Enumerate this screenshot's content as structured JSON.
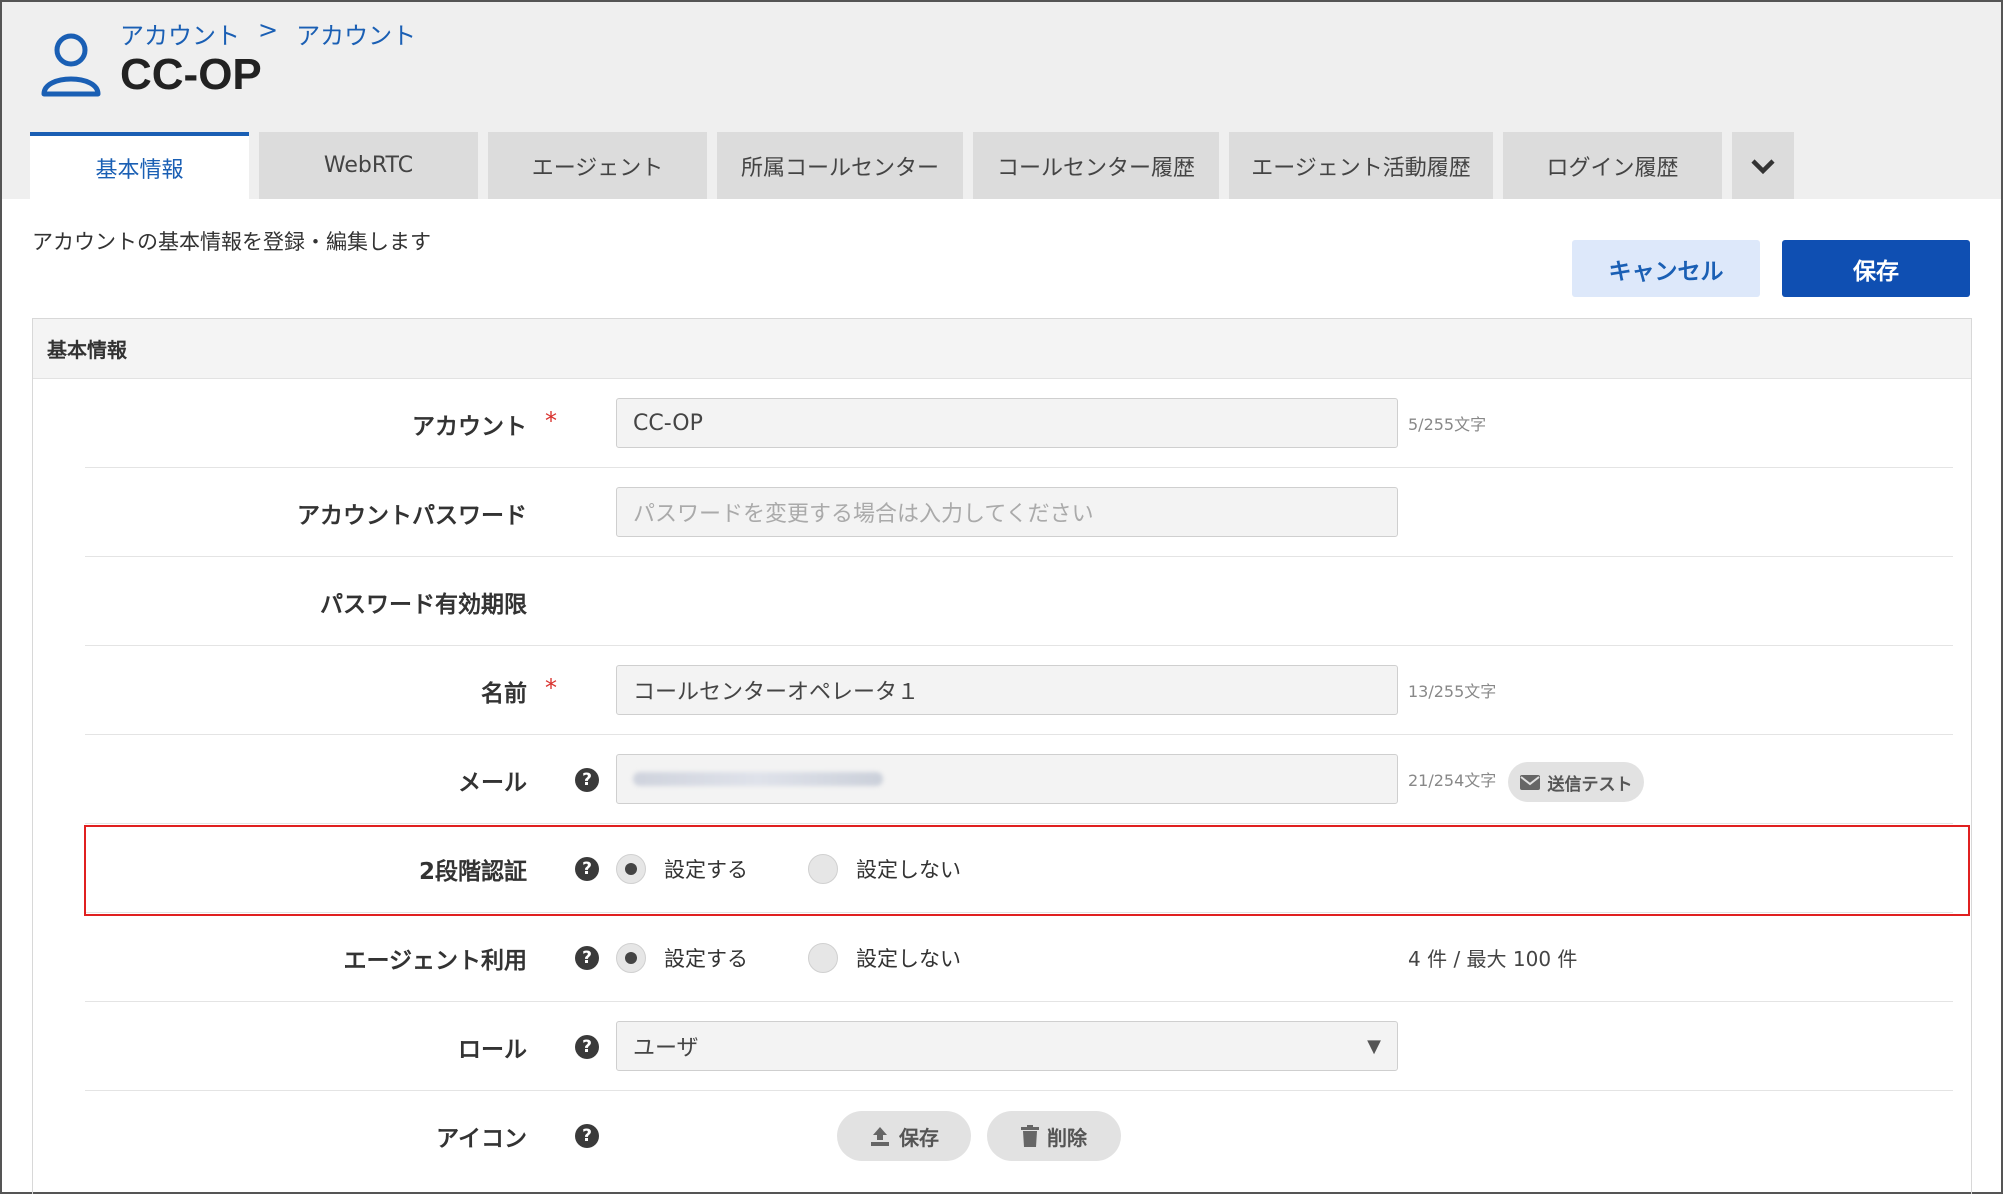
{
  "breadcrumb": [
    "アカウント",
    "アカウント"
  ],
  "breadcrumb_sep": ">",
  "page_title": "CC-OP",
  "tabs": [
    {
      "label": "基本情報",
      "active": true
    },
    {
      "label": "WebRTC"
    },
    {
      "label": "エージェント"
    },
    {
      "label": "所属コールセンター"
    },
    {
      "label": "コールセンター履歴"
    },
    {
      "label": "エージェント活動履歴"
    },
    {
      "label": "ログイン履歴"
    }
  ],
  "intro_text": "アカウントの基本情報を登録・編集します",
  "buttons": {
    "cancel": "キャンセル",
    "save": "保存"
  },
  "panel_title": "基本情報",
  "required_mark": "*",
  "help_mark": "?",
  "fields": {
    "account": {
      "label": "アカウント",
      "value": "CC-OP",
      "count": "5/255文字"
    },
    "password": {
      "label": "アカウントパスワード",
      "placeholder": "パスワードを変更する場合は入力してください"
    },
    "password_expiry": {
      "label": "パスワード有効期限"
    },
    "name": {
      "label": "名前",
      "value": "コールセンターオペレータ１",
      "count": "13/255文字"
    },
    "mail": {
      "label": "メール",
      "count": "21/254文字",
      "test_button": "送信テスト"
    },
    "two_factor": {
      "label": "2段階認証",
      "option_on": "設定する",
      "option_off": "設定しない",
      "selected": "on"
    },
    "agent_use": {
      "label": "エージェント利用",
      "option_on": "設定する",
      "option_off": "設定しない",
      "selected": "on",
      "usage": "4 件 / 最大 100 件"
    },
    "role": {
      "label": "ロール",
      "value": "ユーザ"
    },
    "icon": {
      "label": "アイコン",
      "save": "保存",
      "delete": "削除"
    }
  },
  "colors": {
    "accent": "#1a5fb4",
    "primary_button": "#0f4fb2",
    "highlight": "#e02020",
    "required": "#d9322e"
  }
}
